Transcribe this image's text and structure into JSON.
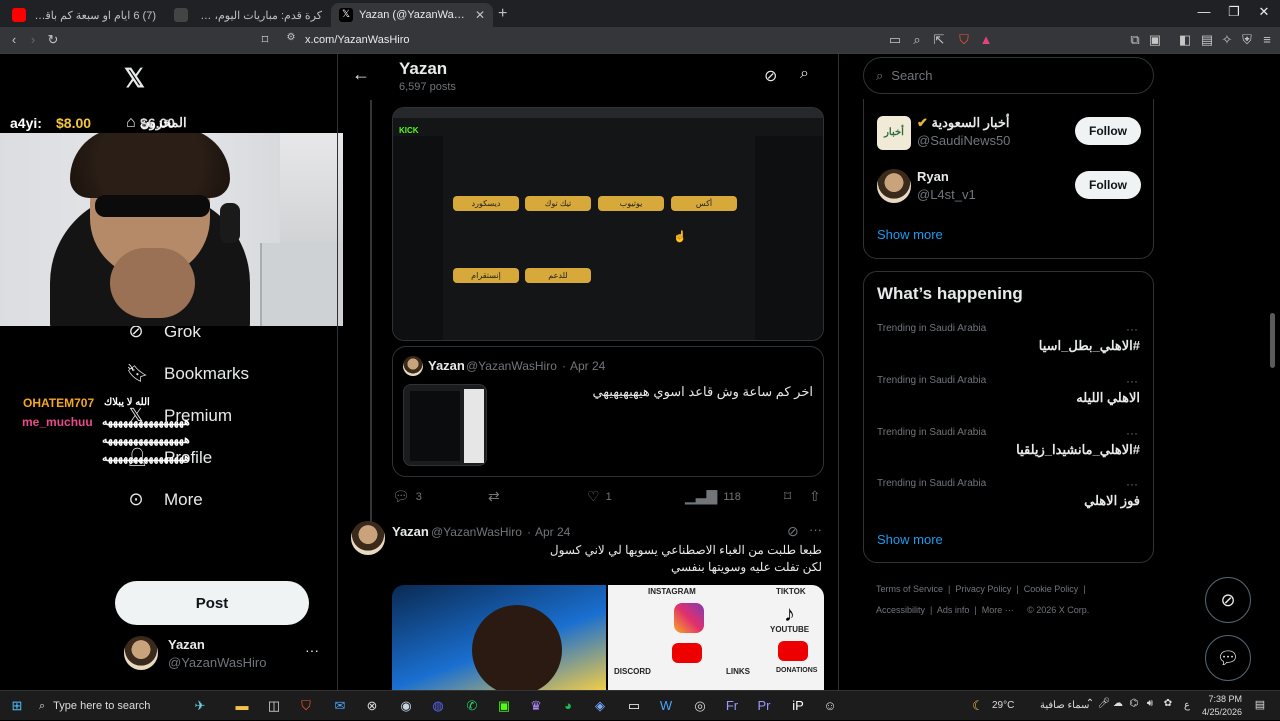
{
  "browser": {
    "tabs": [
      {
        "title": "(7) 6 ايام او سبعة كم باقي على الرجعة",
        "active": false
      },
      {
        "title": "كرة قدم: مباريات اليوم، جدول الترتيب، إ...",
        "active": false
      },
      {
        "title": "Yazan (@YazanWasHiro) / X",
        "active": true
      }
    ],
    "url": "x.com/YazanWasHiro"
  },
  "nav": {
    "items": [
      {
        "label": "Grok",
        "icon": "grok-icon"
      },
      {
        "label": "Bookmarks",
        "icon": "bookmark-icon"
      },
      {
        "label": "Premium",
        "icon": "x-logo-icon"
      },
      {
        "label": "Profile",
        "icon": "person-icon"
      },
      {
        "label": "More",
        "icon": "more-circle-icon"
      }
    ],
    "hidden_label": "المخزون",
    "post_label": "Post",
    "account": {
      "name": "Yazan",
      "handle": "@YazanWasHiro"
    }
  },
  "stream_overlay": {
    "donation_user": "a4yi:",
    "donation_amount": "$8.00",
    "donation_amount2": "$6.00",
    "chat_users": [
      "OHATEM707",
      "me_muchuu"
    ],
    "chat_msg1": "الله لا يبلاك",
    "chat_spam": "ههههههههههههههههه"
  },
  "profile": {
    "name": "Yazan",
    "posts": "6,597 posts"
  },
  "quote": {
    "name": "Yazan",
    "handle": "@YazanWasHiro",
    "date": "Apr 24",
    "text": "اخر كم ساعة وش قاعد اسوي هيهيهيهيهي"
  },
  "actions1": {
    "replies": "3",
    "reposts": "",
    "likes": "1",
    "views": "118"
  },
  "post2": {
    "name": "Yazan",
    "handle": "@YazanWasHiro",
    "date": "Apr 24",
    "line1": "طبعا طلبت من الغباء الاصطناعي يسويها لي لاني كسول",
    "line2": "لكن تفلت عليه وسويتها بنفسي"
  },
  "search": {
    "placeholder": "Search"
  },
  "who_to_follow": {
    "accounts": [
      {
        "name": "أخبار السعودية",
        "handle": "@SaudiNews50",
        "button": "Follow"
      },
      {
        "name": "Ryan",
        "handle": "@L4st_v1",
        "button": "Follow"
      }
    ],
    "show_more": "Show more"
  },
  "trending": {
    "title": "What’s happening",
    "items": [
      {
        "meta": "Trending in Saudi Arabia",
        "name": "#الاهلي_بطل_اسيا"
      },
      {
        "meta": "Trending in Saudi Arabia",
        "name": "الاهلي الليله"
      },
      {
        "meta": "Trending in Saudi Arabia",
        "name": "#الاهلي_مانشيدا_زيلقيا"
      },
      {
        "meta": "Trending in Saudi Arabia",
        "name": "فوز الاهلي"
      }
    ],
    "show_more": "Show more"
  },
  "footer": {
    "links": [
      "Terms of Service",
      "Privacy Policy",
      "Cookie Policy",
      "Accessibility",
      "Ads info",
      "More ···"
    ],
    "copyright": "© 2026 X Corp."
  },
  "screenshot_labels": {
    "app": "KICK",
    "buttons": [
      "ديسكورد",
      "تيك توك",
      "يوتيوب",
      "أكس",
      "إنستقرام",
      "للدعم"
    ]
  },
  "thumb_labels": [
    "INSTAGRAM",
    "TIKTOK",
    "YOUTUBE",
    "DISCORD",
    "LINKS",
    "DONATIONS"
  ],
  "taskbar": {
    "search_placeholder": "Type here to search",
    "weather_temp": "29°C",
    "weather_desc": "سماء صافية",
    "lang": "ع",
    "time": "7:38 PM",
    "date": "4/25/2026"
  },
  "colors": {
    "accent": "#1d9bf0",
    "bg": "#000000",
    "border": "#2f3336",
    "muted": "#71767b"
  }
}
